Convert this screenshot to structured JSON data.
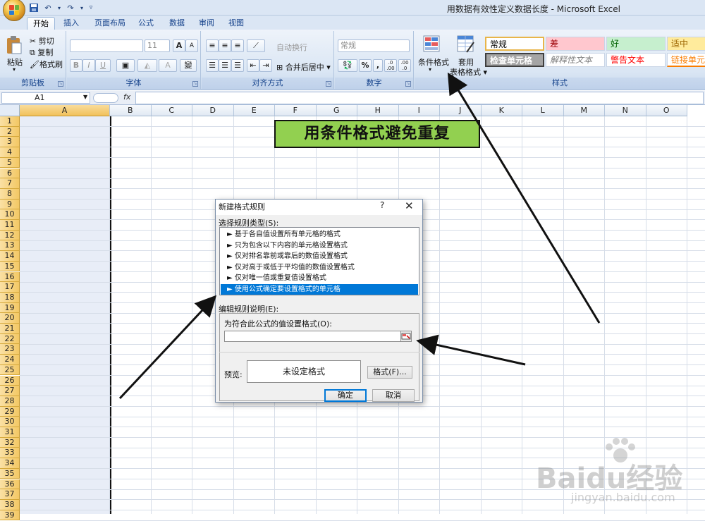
{
  "window": {
    "title": "用数据有效性定义数据长度 - Microsoft Excel"
  },
  "qat": {
    "save_icon": "save-icon",
    "undo_icon": "undo-icon",
    "redo_icon": "redo-icon"
  },
  "tabs": [
    {
      "label": "开始",
      "active": true
    },
    {
      "label": "插入"
    },
    {
      "label": "页面布局"
    },
    {
      "label": "公式"
    },
    {
      "label": "数据"
    },
    {
      "label": "审阅"
    },
    {
      "label": "视图"
    }
  ],
  "ribbon": {
    "clipboard": {
      "label": "剪贴板",
      "paste": "粘贴",
      "cut": "剪切",
      "copy": "复制",
      "format_painter": "格式刷"
    },
    "font": {
      "label": "字体",
      "font_name": "",
      "font_size": "11",
      "bold": "B",
      "italic": "I",
      "underline": "U",
      "grow": "A",
      "shrink": "A",
      "wen": "變"
    },
    "alignment": {
      "label": "对齐方式",
      "wrap": "自动换行",
      "merge": "合并后居中"
    },
    "number": {
      "label": "数字",
      "format": "常规",
      "percent": "%",
      "comma": ",",
      "inc": ".0 .00",
      "dec": ".00 .0"
    },
    "styles": {
      "label": "样式",
      "conditional": "条件格式",
      "table_fmt_1": "套用",
      "table_fmt_2": "表格格式",
      "cells": [
        {
          "text": "常规",
          "bg": "#ffffff",
          "fg": "#000000"
        },
        {
          "text": "差",
          "bg": "#ffc7ce",
          "fg": "#9c0006"
        },
        {
          "text": "好",
          "bg": "#c6efce",
          "fg": "#006100"
        },
        {
          "text": "适中",
          "bg": "#ffeb9c",
          "fg": "#9c6500"
        },
        {
          "text": "检查单元格",
          "bg": "#a5a5a5",
          "fg": "#ffffff"
        },
        {
          "text": "解释性文本",
          "bg": "#ffffff",
          "fg": "#7f7f7f"
        },
        {
          "text": "警告文本",
          "bg": "#ffffff",
          "fg": "#ff0000"
        },
        {
          "text": "链接单元",
          "bg": "#ffffff",
          "fg": "#fa7d00"
        }
      ]
    }
  },
  "formula_bar": {
    "name_box": "A1",
    "fx": "fx",
    "formula": ""
  },
  "sheet": {
    "columns": [
      "A",
      "B",
      "C",
      "D",
      "E",
      "F",
      "G",
      "H",
      "I",
      "J",
      "K",
      "L",
      "M",
      "N",
      "O"
    ],
    "rows": [
      "1",
      "2",
      "3",
      "4",
      "5",
      "6",
      "7",
      "8",
      "9",
      "10",
      "11",
      "12",
      "13",
      "14",
      "15",
      "16",
      "17",
      "18",
      "19",
      "20",
      "21",
      "22",
      "23",
      "24",
      "25",
      "26",
      "27",
      "28",
      "29",
      "30",
      "31",
      "32",
      "33",
      "34",
      "35",
      "36",
      "37",
      "38",
      "39"
    ],
    "banner": "用条件格式避免重复"
  },
  "dialog": {
    "title": "新建格式规则",
    "help": "?",
    "close": "✕",
    "select_rule_label": "选择规则类型(S):",
    "rules": [
      "► 基于各自值设置所有单元格的格式",
      "► 只为包含以下内容的单元格设置格式",
      "► 仅对排名靠前或靠后的数值设置格式",
      "► 仅对高于或低于平均值的数值设置格式",
      "► 仅对唯一值或重复值设置格式",
      "► 使用公式确定要设置格式的单元格"
    ],
    "selected_rule_index": 5,
    "edit_label": "编辑规则说明(E):",
    "formula_label": "为符合此公式的值设置格式(O):",
    "formula_value": "",
    "preview_label": "预览:",
    "preview_text": "未设定格式",
    "format_button": "格式(F)...",
    "ok": "确定",
    "cancel": "取消"
  },
  "watermark": {
    "brand": "Baidu经验",
    "url": "jingyan.baidu.com"
  }
}
